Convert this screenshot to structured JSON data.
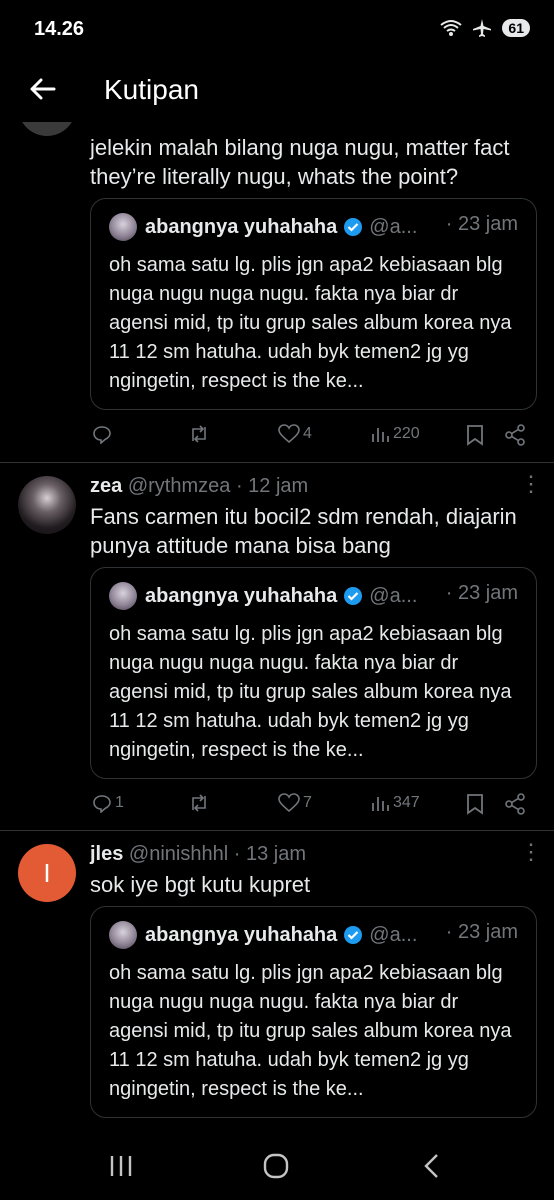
{
  "status": {
    "time": "14.26",
    "battery": "61"
  },
  "header": {
    "title": "Kutipan"
  },
  "quoted": {
    "name": "abangnya yuhahaha",
    "handle": "@a...",
    "time": "· 23 jam",
    "text": "oh sama satu lg. plis jgn apa2 kebiasaan blg nuga nugu nuga nugu. fakta nya biar dr agensi mid, tp itu grup sales album korea nya 11 12 sm hatuha. udah byk temen2 jg yg ngingetin, respect is the ke..."
  },
  "tweets": [
    {
      "text_partial": "jelekin malah bilang nuga nugu, matter fact they’re literally nugu, whats the point?",
      "replies": "",
      "likes": "4",
      "views": "220"
    },
    {
      "name": "zea",
      "handle": "@rythmzea",
      "time": "· 12 jam",
      "text": "Fans carmen itu bocil2 sdm rendah, diajarin punya attitude mana bisa bang",
      "replies": "1",
      "likes": "7",
      "views": "347"
    },
    {
      "name": "jles",
      "handle": "@ninishhhl",
      "time": "· 13 jam",
      "avatar_letter": "I",
      "text": "sok iye bgt kutu kupret"
    }
  ],
  "colors": {
    "accent": "#1d9bf0",
    "text": "#e7e9ea",
    "muted": "#71767b",
    "border": "#2f3336",
    "jles_avatar": "#e35b34"
  }
}
